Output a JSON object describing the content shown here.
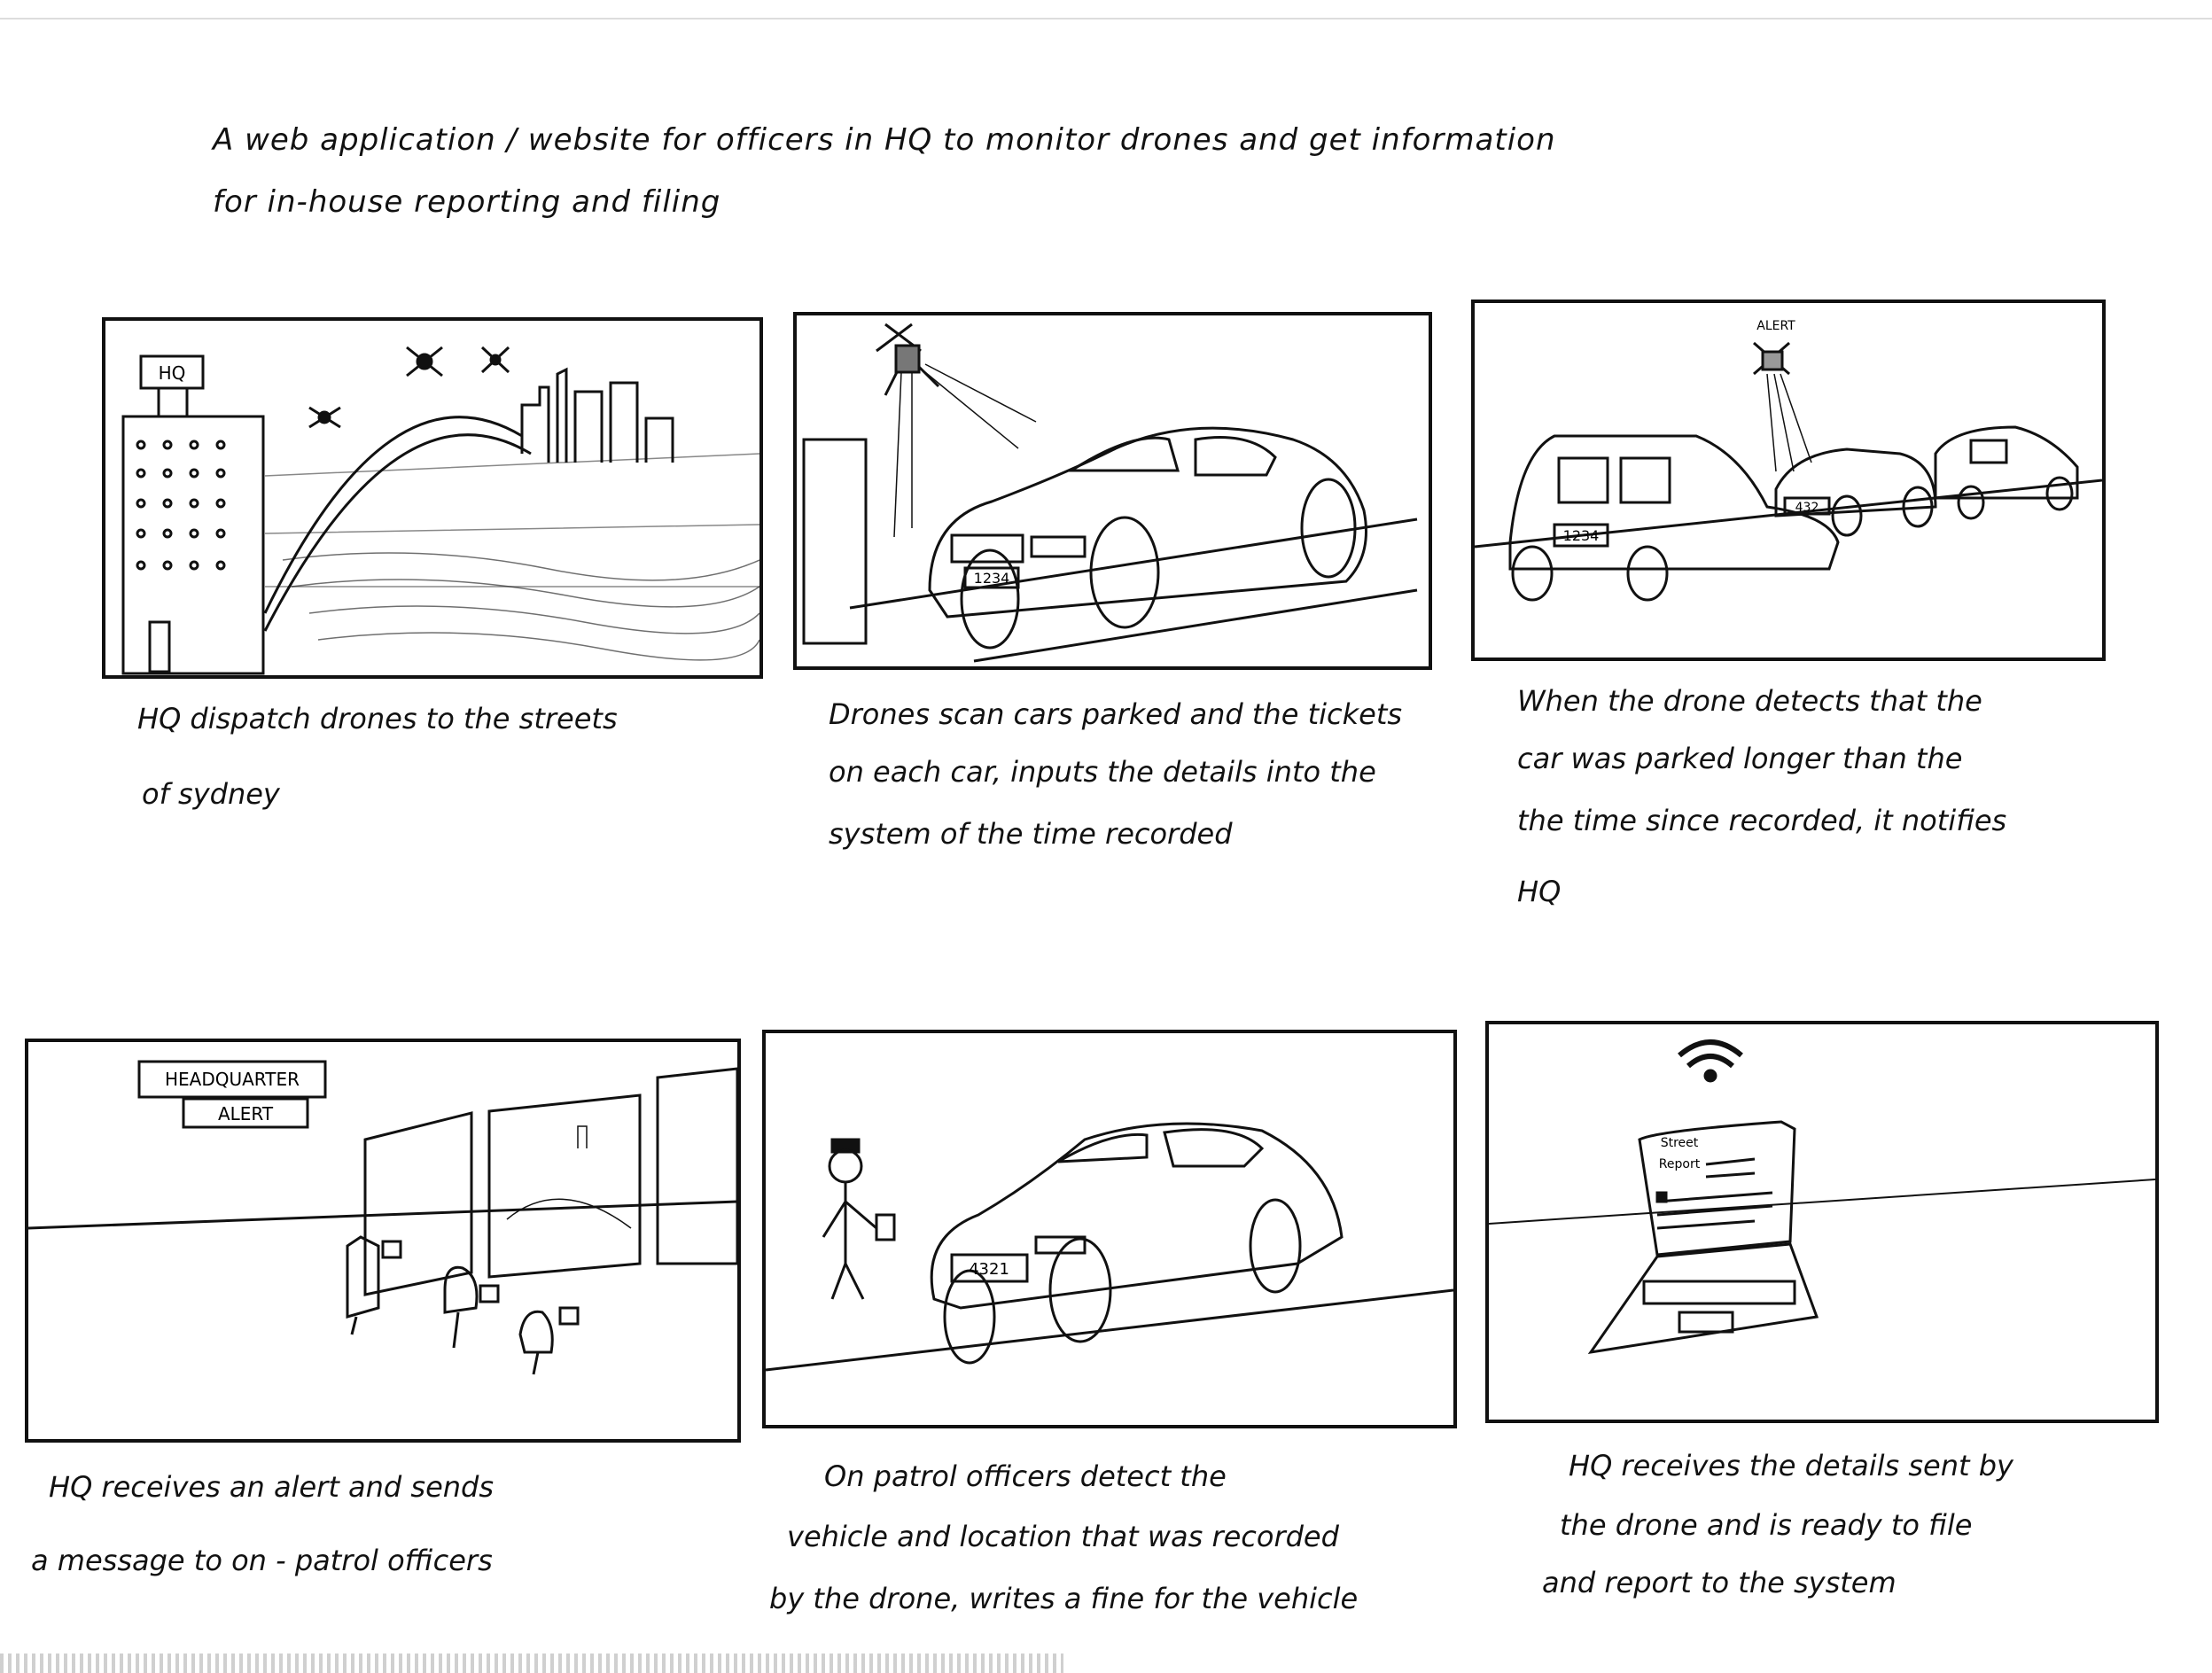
{
  "intro": {
    "line1": "A web application / website for officers in HQ to monitor drones and get information",
    "line2": "for in-house reporting and filing"
  },
  "panels": [
    {
      "id": "p1",
      "labels": {
        "building_sign": "HQ"
      },
      "caption": [
        "HQ dispatch drones to the streets",
        "of sydney"
      ]
    },
    {
      "id": "p2",
      "labels": {
        "plate": "1234"
      },
      "caption": [
        "Drones scan cars parked and the tickets",
        "on each car, inputs the details into the",
        "system of the time recorded"
      ]
    },
    {
      "id": "p3",
      "labels": {
        "drone_alert": "ALERT",
        "plate_a": "1234",
        "plate_b": "432"
      },
      "caption": [
        "When the drone detects that the",
        "car was parked longer than the",
        "the time since recorded, it notifies",
        "HQ"
      ]
    },
    {
      "id": "p4",
      "labels": {
        "sign_top": "HEADQUARTER",
        "sign_bottom": "ALERT"
      },
      "caption": [
        "HQ receives an alert and sends",
        "a message to on - patrol officers"
      ]
    },
    {
      "id": "p5",
      "labels": {
        "plate": "4321"
      },
      "caption": [
        "On patrol officers detect the",
        "vehicle and location that was recorded",
        "by the drone, writes a fine for the vehicle"
      ]
    },
    {
      "id": "p6",
      "labels": {
        "screen_line1": "Street",
        "screen_line2": "Report"
      },
      "caption": [
        "HQ receives the details sent by",
        "the drone and is ready to file",
        "and report to the system"
      ]
    }
  ]
}
